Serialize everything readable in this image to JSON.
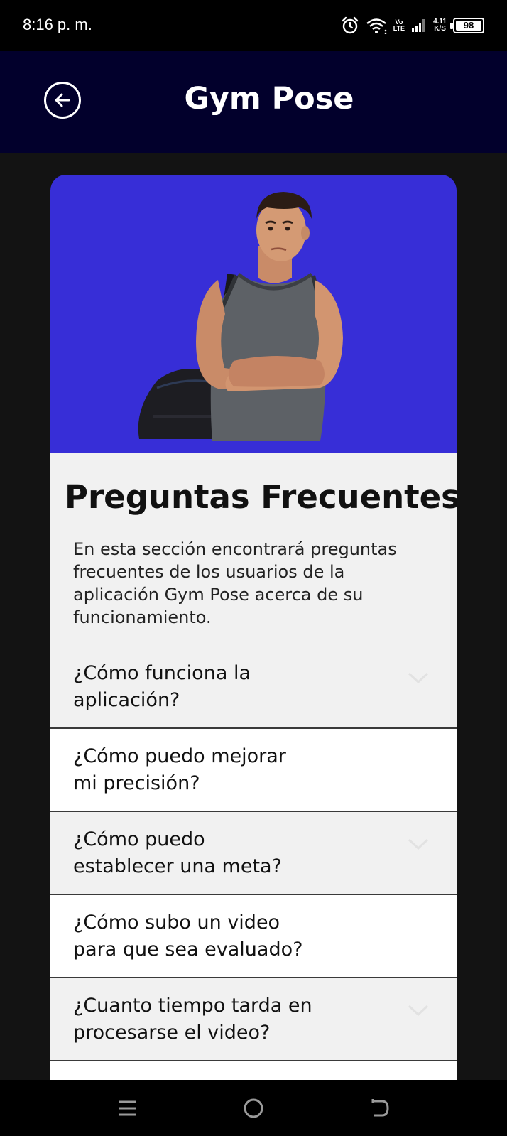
{
  "status_bar": {
    "time": "8:16 p. m.",
    "volte_top": "Vo",
    "volte_bottom": "LTE",
    "speed_value": "4.11",
    "speed_unit": "K/S",
    "battery": "98",
    "icons": [
      "alarm-icon",
      "wifi-icon",
      "volte-icon",
      "signal-icon",
      "battery-icon"
    ]
  },
  "header": {
    "title": "Gym Pose",
    "back_icon": "back-arrow-icon"
  },
  "hero": {
    "image": "man-with-gym-bag-illustration",
    "background": "#372ed7"
  },
  "faq": {
    "title": "Preguntas Frecuentes",
    "intro": "En esta sección encontrará preguntas frecuentes de los usuarios de la aplicación Gym Pose acerca de su funcionamiento.",
    "items": [
      {
        "question": "¿Cómo funciona la\naplicación?"
      },
      {
        "question": "¿Cómo puedo mejorar\nmi precisión?"
      },
      {
        "question": "¿Cómo puedo\nestablecer una meta?"
      },
      {
        "question": "¿Cómo subo un video\npara que sea evaluado?"
      },
      {
        "question": "¿Cuanto tiempo tarda en\nprocesarse el video?"
      }
    ]
  },
  "nav_bar": {
    "icons": [
      "menu-icon",
      "home-icon",
      "back-icon"
    ]
  },
  "colors": {
    "header_bg": "#02002c",
    "hero_bg": "#372ed7",
    "page_bg": "#131313",
    "card_bg": "#f1f1f1"
  }
}
